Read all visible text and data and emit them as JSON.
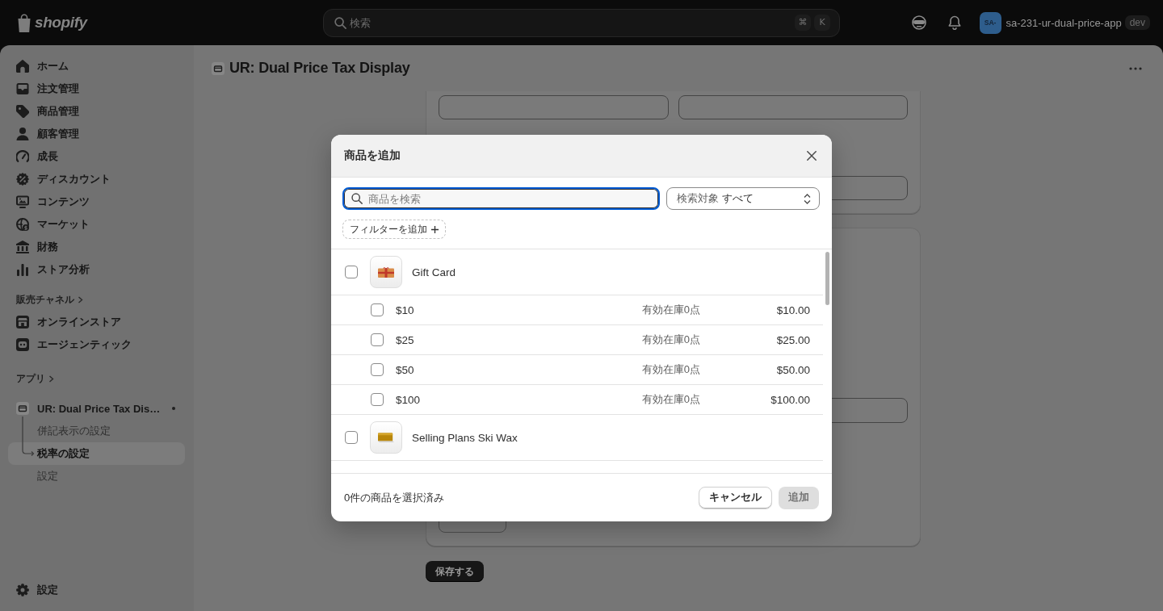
{
  "top_bar": {
    "logo_text": "shopify",
    "search": {
      "placeholder": "検索",
      "shortcut_keys": [
        "⌘",
        "K"
      ]
    },
    "store": {
      "avatar_text": "SA-",
      "name": "sa-231-ur-dual-price-app",
      "badge": "dev"
    }
  },
  "sidebar": {
    "items": [
      {
        "label": "ホーム"
      },
      {
        "label": "注文管理"
      },
      {
        "label": "商品管理"
      },
      {
        "label": "顧客管理"
      },
      {
        "label": "成長"
      },
      {
        "label": "ディスカウント"
      },
      {
        "label": "コンテンツ"
      },
      {
        "label": "マーケット"
      },
      {
        "label": "財務"
      },
      {
        "label": "ストア分析"
      }
    ],
    "sales_channels": {
      "heading": "販売チャネル",
      "items": [
        {
          "label": "オンラインストア"
        },
        {
          "label": "エージェンティック"
        }
      ]
    },
    "apps": {
      "heading": "アプリ",
      "app": {
        "label": "UR: Dual Price Tax Dis…",
        "children": [
          {
            "label": "併記表示の設定",
            "selected": false
          },
          {
            "label": "税率の設定",
            "selected": true
          },
          {
            "label": "設定",
            "selected": false
          }
        ]
      }
    },
    "settings": {
      "label": "設定"
    }
  },
  "page": {
    "title": "UR: Dual Price Tax Display",
    "save_button": "保存する"
  },
  "modal": {
    "title": "商品を追加",
    "search": {
      "placeholder": "商品を検索",
      "focused": true
    },
    "scope_select": {
      "label": "検索対象",
      "value": "すべて"
    },
    "filter_button": "フィルターを追加",
    "products": [
      {
        "title": "Gift Card",
        "checked": false,
        "variants": [
          {
            "title": "$10",
            "checked": false,
            "stock": "有効在庫0点",
            "price": "$10.00"
          },
          {
            "title": "$25",
            "checked": false,
            "stock": "有効在庫0点",
            "price": "$25.00"
          },
          {
            "title": "$50",
            "checked": false,
            "stock": "有効在庫0点",
            "price": "$50.00"
          },
          {
            "title": "$100",
            "checked": false,
            "stock": "有効在庫0点",
            "price": "$100.00"
          }
        ]
      },
      {
        "title": "Selling Plans Ski Wax",
        "checked": false
      }
    ],
    "footer": {
      "selection_count": "0件の商品を選択済み",
      "buttons": [
        {
          "label": "キャンセル",
          "kind": "secondary",
          "disabled": false
        },
        {
          "label": "追加",
          "kind": "primary",
          "disabled": true
        }
      ]
    }
  }
}
